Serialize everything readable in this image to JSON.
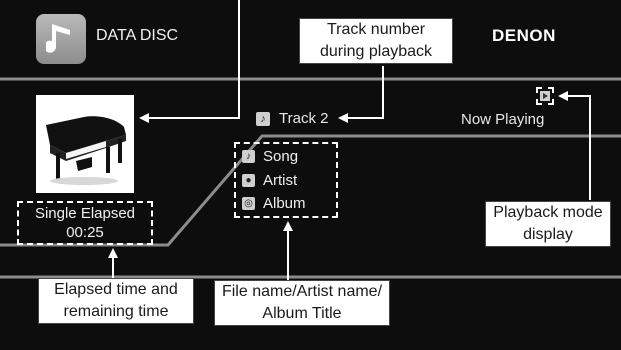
{
  "header": {
    "source_title": "DATA DISC",
    "brand": "DENON",
    "source_icon": "music-note-icon"
  },
  "playback": {
    "track_icon": "music-note-icon",
    "track_label": "Track 2",
    "status": "Now Playing",
    "mode_icon": "play-icon",
    "song": "Song",
    "artist": "Artist",
    "album": "Album",
    "song_icon": "music-note-icon",
    "artist_icon": "person-icon",
    "album_icon": "disc-icon",
    "elapsed_label": "Single Elapsed",
    "elapsed_time": "00:25",
    "album_art": "grand-piano-image"
  },
  "callouts": {
    "track_number_line1": "Track number",
    "track_number_line2": "during playback",
    "playback_mode_line1": "Playback mode",
    "playback_mode_line2": "display",
    "elapsed_line1": "Elapsed time and",
    "elapsed_line2": "remaining time",
    "file_line1": "File name/Artist name/",
    "file_line2": "Album Title"
  },
  "colors": {
    "background": "#0d0d0d",
    "divider": "#8c8c8c",
    "callout_bg": "#ffffff",
    "callout_text": "#1a1a1a"
  }
}
